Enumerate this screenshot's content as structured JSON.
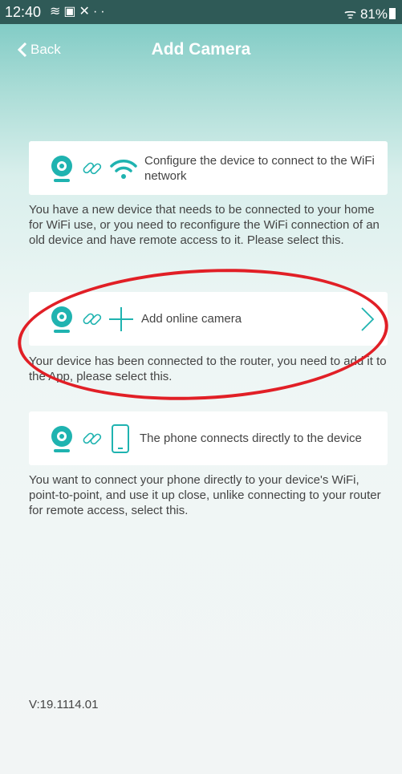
{
  "status_bar": {
    "time": "12:40",
    "icons": [
      "wifi-icon",
      "gallery-icon",
      "missed-call-icon",
      "more-dots-icon"
    ],
    "battery": "81%"
  },
  "nav": {
    "back_label": "Back",
    "title": "Add Camera"
  },
  "options": [
    {
      "label": "Configure the device to connect to the WiFi network",
      "description": "You have a new device that needs to be connected to your home for WiFi use, or you need to reconfigure the WiFi connection of an old device and have remote access to it. Please select this."
    },
    {
      "label": "Add online camera",
      "description": "Your device has been connected to the router, you need to add it to the App, please select this."
    },
    {
      "label": "The phone connects directly to the device",
      "description": "You want to connect your phone directly to your device's WiFi, point-to-point, and use it up close, unlike connecting to your router for remote access, select this."
    }
  ],
  "version": "V:19.1114.01",
  "colors": {
    "accent": "#1fb3b0",
    "header_top": "#74c6c0",
    "annotation": "#e11f26"
  }
}
